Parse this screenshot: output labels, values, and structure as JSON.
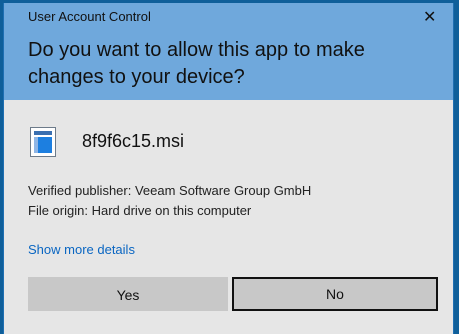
{
  "window": {
    "title": "User Account Control",
    "close_glyph": "✕"
  },
  "header": {
    "question": "Do you want to allow this app to make changes to your device?"
  },
  "app": {
    "icon": "msi-installer-icon",
    "name": "8f9f6c15.msi"
  },
  "details": {
    "publisher": "Verified publisher: Veeam Software Group GmbH",
    "origin": "File origin: Hard drive on this computer"
  },
  "links": {
    "show_more": "Show more details"
  },
  "buttons": {
    "yes_label": "Yes",
    "no_label": "No"
  },
  "colors": {
    "header_bg": "#6fa8dc",
    "body_bg": "#e6e6e6",
    "link": "#0a66c2",
    "button_bg": "#c8c8c8"
  }
}
